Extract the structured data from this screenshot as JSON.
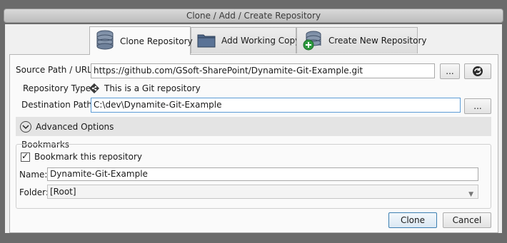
{
  "window": {
    "title": "Clone / Add / Create Repository"
  },
  "tabs": [
    {
      "label": "Clone Repository",
      "icon": "database-icon",
      "active": true
    },
    {
      "label": "Add Working Copy",
      "icon": "folder-icon",
      "active": false
    },
    {
      "label": "Create New Repository",
      "icon": "database-add-icon",
      "active": false
    }
  ],
  "form": {
    "source_label": "Source Path / URL:",
    "source_value": "https://github.com/GSoft-SharePoint/Dynamite-Git-Example.git",
    "browse_label": "...",
    "repo_type_label": "Repository Type:",
    "repo_type_value": "This is a Git repository",
    "dest_label": "Destination Path:",
    "dest_value": "C:\\dev\\Dynamite-Git-Example",
    "dest_browse_label": "..."
  },
  "advanced": {
    "label": "Advanced Options"
  },
  "bookmarks": {
    "title": "Bookmarks",
    "checkbox_label": "Bookmark this repository",
    "checked": true,
    "name_label": "Name:",
    "name_value": "Dynamite-Git-Example",
    "folder_label": "Folder:",
    "folder_value": "[Root]"
  },
  "buttons": {
    "clone": "Clone",
    "cancel": "Cancel"
  },
  "colors": {
    "accent": "#3c7fb1",
    "git": "#3b3b3b",
    "add": "#2e9a3f"
  }
}
